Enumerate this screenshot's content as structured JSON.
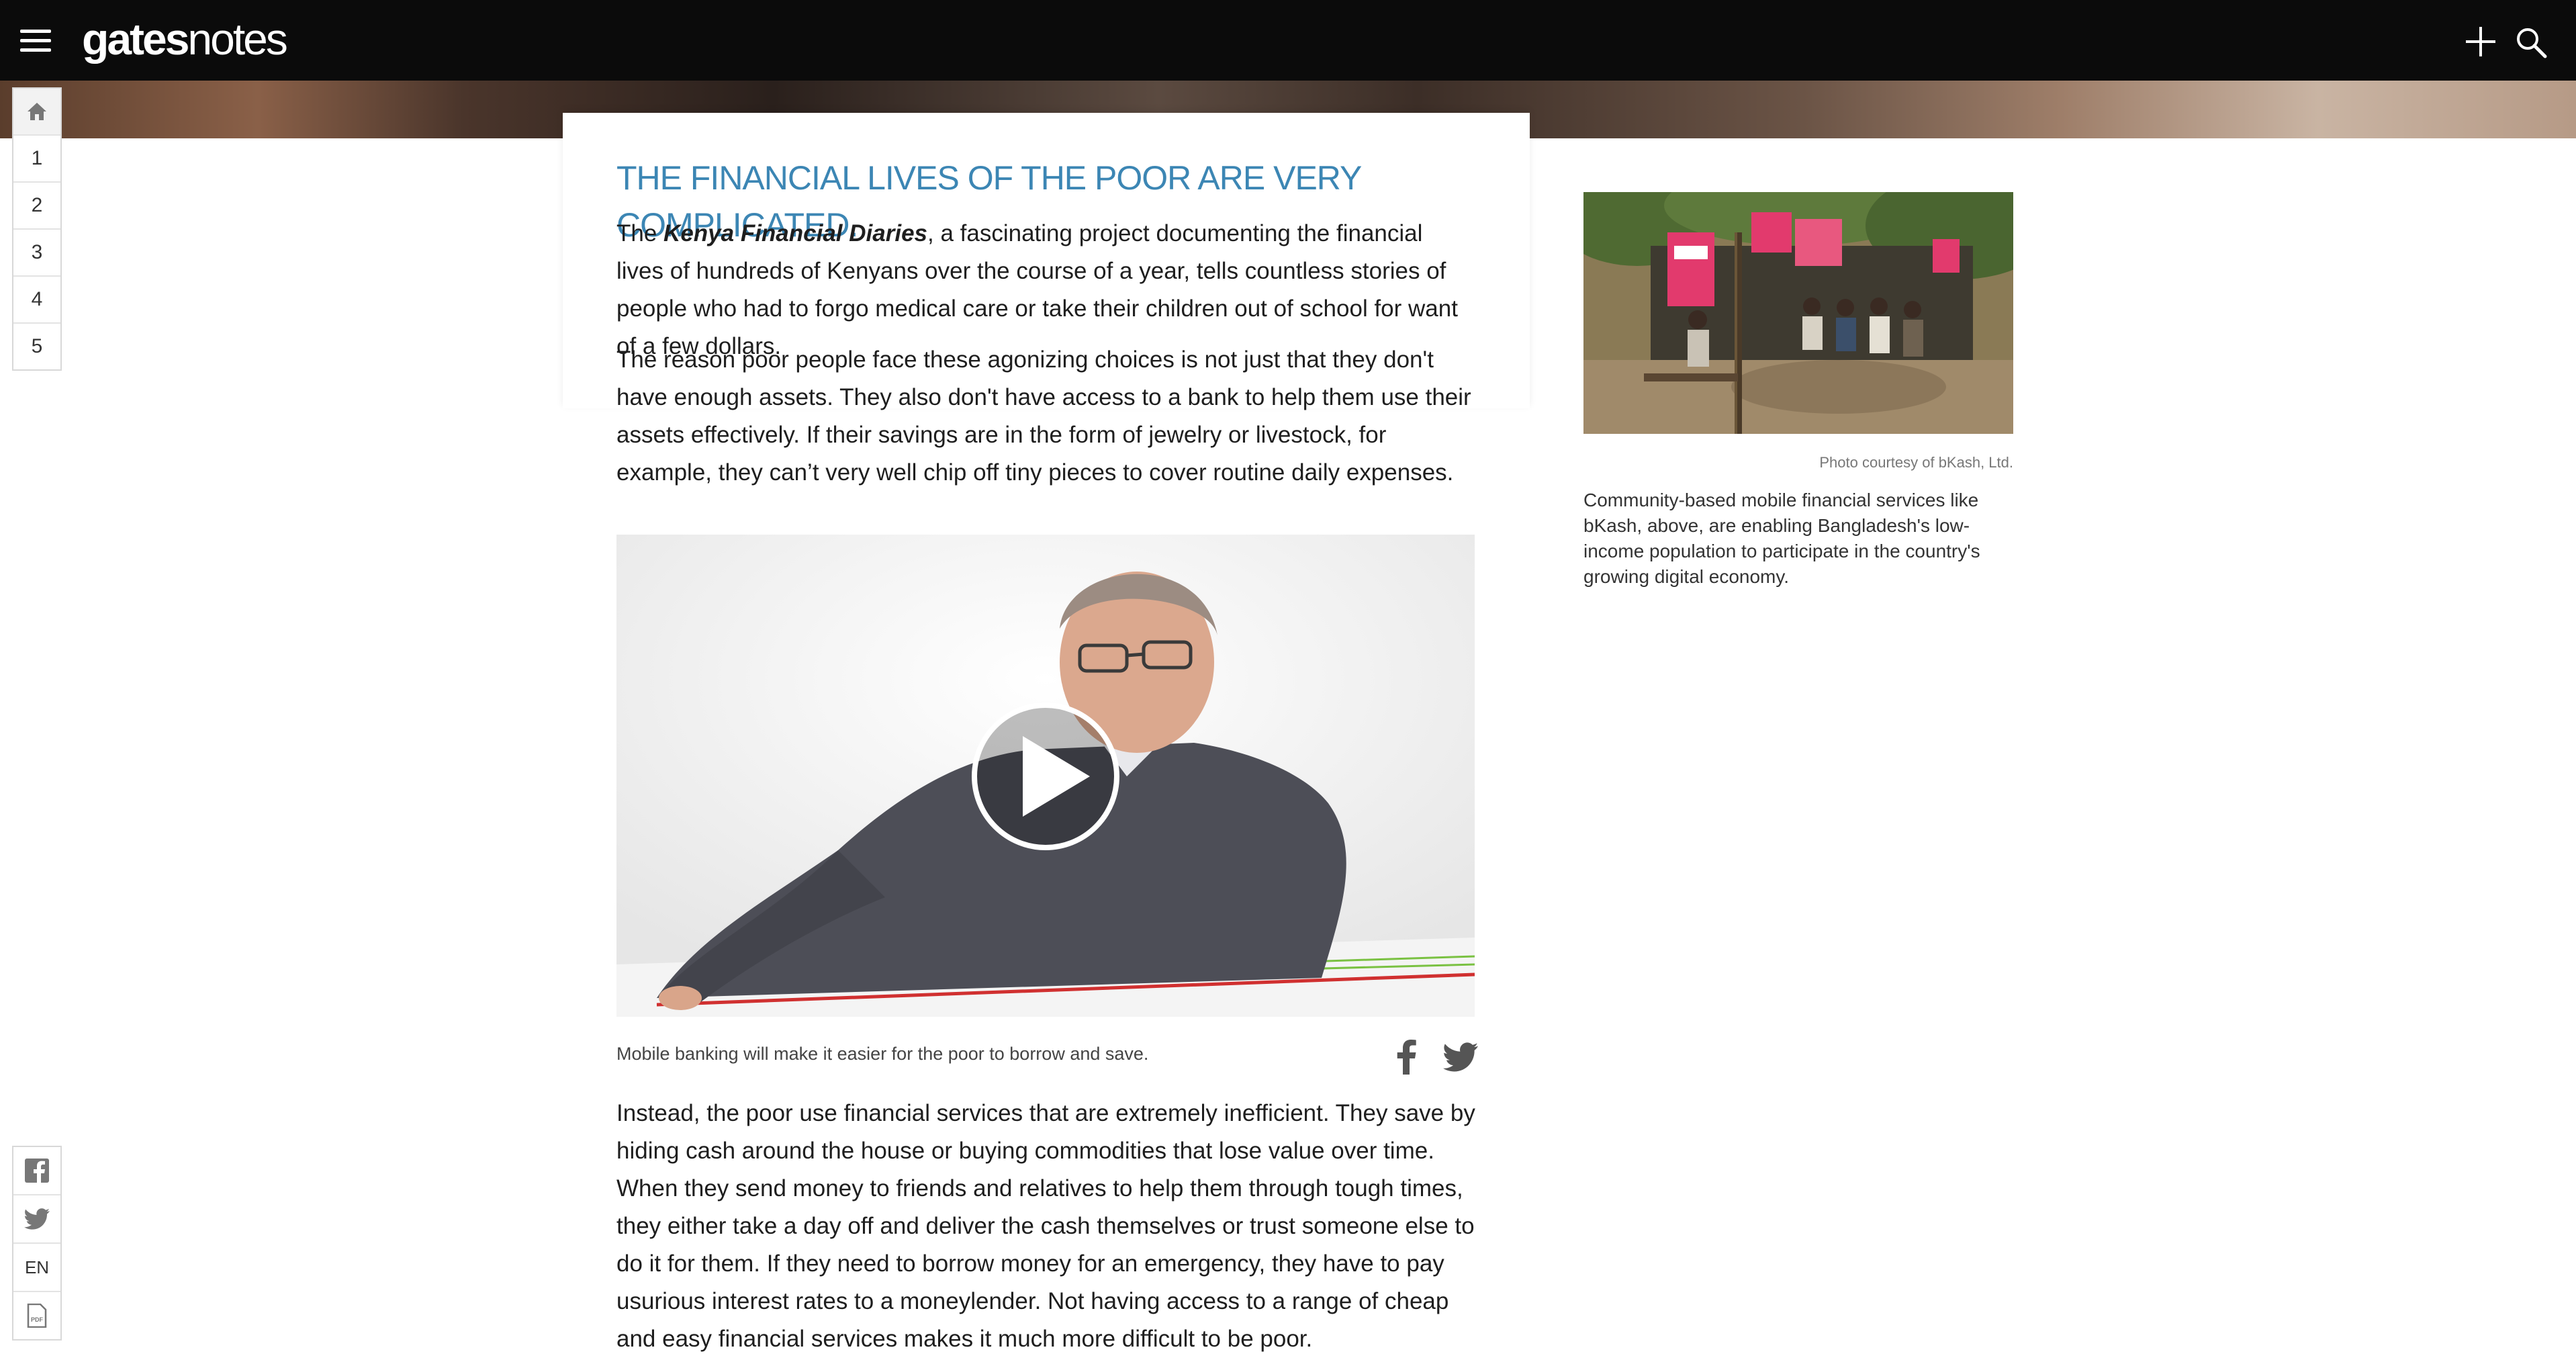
{
  "header": {
    "logo_bold": "gates",
    "logo_light": "notes"
  },
  "rail": {
    "chapters": [
      "1",
      "2",
      "3",
      "4",
      "5"
    ],
    "language": "EN",
    "pdf_label": "PDF"
  },
  "article": {
    "heading": "The financial lives of the poor are very complicated.",
    "p1_pre": "The ",
    "p1_italic": "Kenya Financial Diaries",
    "p1_post": ", a fascinating project documenting the financial lives of hundreds of Kenyans over the course of a year, tells countless stories of people who had to forgo medical care or take their children out of school for want of a few dollars.",
    "p2": "The reason poor people face these agonizing choices is not just that they don't have enough assets. They also don't have access to a bank to help them use their assets effectively. If their savings are in the form of jewelry or livestock, for example, they can’t very well chip off tiny pieces to cover routine daily expenses.",
    "video_caption": "Mobile banking will make it easier for the poor to borrow and save.",
    "p3": "Instead, the poor use financial services that are extremely inefficient. They save by hiding cash around the house or buying commodities that lose value over time. When they send money to friends and relatives to help them through tough times, they either take a day off and deliver the cash themselves or trust someone else to do it for them. If they need to borrow money for an emergency, they have to pay usurious interest rates to a moneylender. Not having access to a range of cheap and easy financial services makes it much more difficult to be poor."
  },
  "sidebar": {
    "photo_credit": "Photo courtesy of bKash, Ltd.",
    "photo_caption": "Community-based mobile financial services like bKash, above, are enabling Bangladesh's low-income population to participate in the country's growing digital economy."
  },
  "colors": {
    "topbar": "#0b0b0b",
    "heading": "#3c86b4",
    "body_text": "#1e1e1e"
  }
}
